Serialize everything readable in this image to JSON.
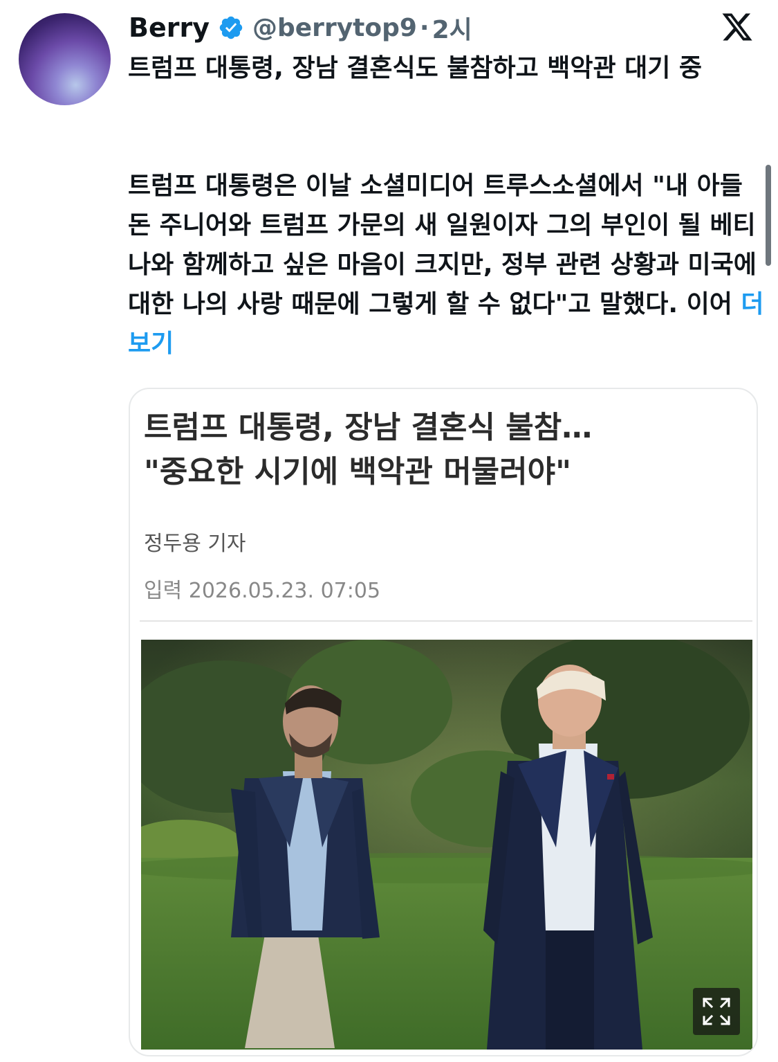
{
  "author": {
    "display_name": "Berry",
    "handle": "@berrytop9",
    "separator": "·",
    "time_ago": "2시",
    "verified": true
  },
  "platform_icon": "x-logo-icon",
  "tweet": {
    "title": "트럼프 대통령, 장남 결혼식도 불참하고 백악관 대기 중",
    "body": "트럼프 대통령은 이날 소셜미디어 트루스소셜에서 \"내 아들 돈 주니어와 트럼프 가문의 새 일원이자 그의 부인이 될 베티나와 함께하고 싶은 마음이 크지만, 정부 관련 상황과 미국에 대한 나의 사랑 때문에 그렇게 할 수 없다\"고 말했다. 이어 ",
    "show_more": "더 보기"
  },
  "card": {
    "headline": "트럼프 대통령, 장남 결혼식 불참…\n\"중요한 시기에 백악관 머물러야\"",
    "reporter": "정두용 기자",
    "date": "입력 2026.05.23. 07:05",
    "expand_icon": "expand-icon"
  },
  "colors": {
    "link": "#1d9bf0",
    "verified": "#1d9bf0",
    "handle": "#536471",
    "text": "#0f1419"
  }
}
